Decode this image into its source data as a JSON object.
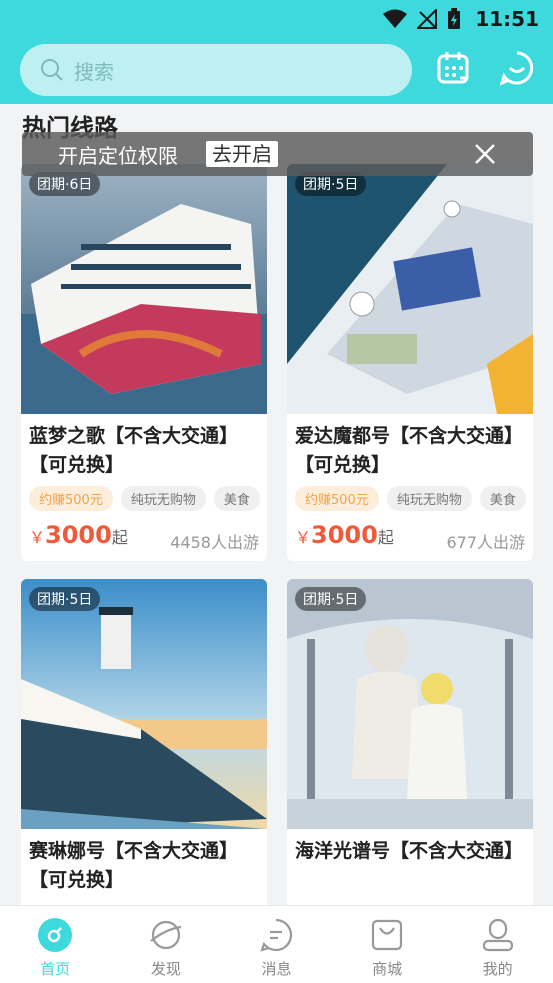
{
  "status_bar": {
    "time": "11:51"
  },
  "header": {
    "search_placeholder": "搜索",
    "calendar_icon": "calendar-icon",
    "chat_icon": "chat-smile-icon"
  },
  "section": {
    "title": "热门线路"
  },
  "location_banner": {
    "text": "开启定位权限",
    "button": "去开启"
  },
  "cards": [
    {
      "days": "团期·6日",
      "title": "蓝梦之歌【不含大交通】【可兑换】",
      "tags": [
        "约赚500元",
        "纯玩无购物",
        "美食"
      ],
      "currency": "￥",
      "price": "3000",
      "suffix": "起",
      "travelers": "4458人出游"
    },
    {
      "days": "团期·5日",
      "title": "爱达魔都号【不含大交通】【可兑换】",
      "tags": [
        "约赚500元",
        "纯玩无购物",
        "美食"
      ],
      "currency": "￥",
      "price": "3000",
      "suffix": "起",
      "travelers": "677人出游"
    },
    {
      "days": "团期·5日",
      "title": "赛琳娜号【不含大交通】【可兑换】"
    },
    {
      "days": "团期·5日",
      "title": "海洋光谱号【不含大交通】"
    }
  ],
  "tabbar": [
    {
      "label": "首页",
      "icon": "home-icon",
      "active": true
    },
    {
      "label": "发现",
      "icon": "discover-planet-icon"
    },
    {
      "label": "消息",
      "icon": "message-icon"
    },
    {
      "label": "商城",
      "icon": "shop-bag-icon"
    },
    {
      "label": "我的",
      "icon": "profile-icon"
    }
  ],
  "colors": {
    "accent": "#3dd9dd",
    "price": "#f05a3a",
    "earn": "#f0a24b"
  }
}
